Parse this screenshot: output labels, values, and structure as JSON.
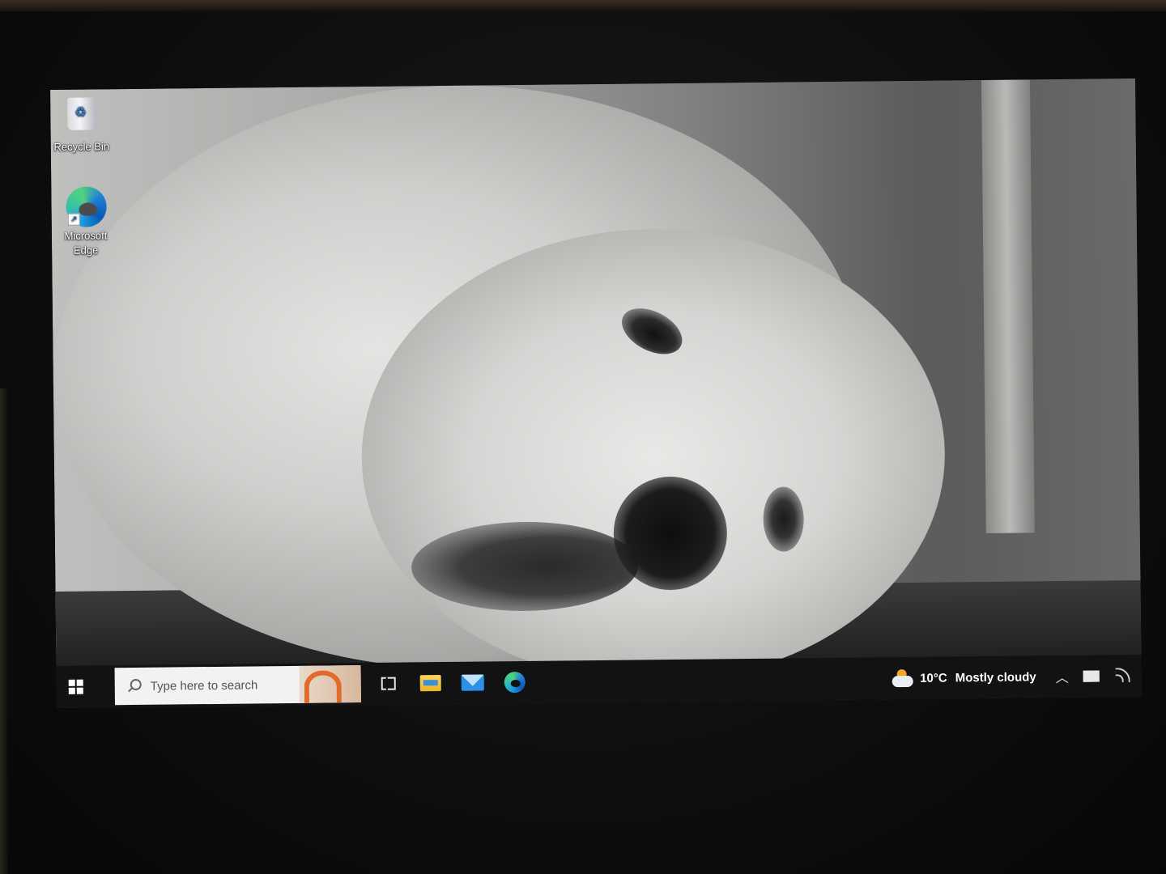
{
  "desktop": {
    "icons": [
      {
        "label": "Recycle Bin",
        "icon": "recycle-bin-icon"
      },
      {
        "label": "Microsoft Edge",
        "icon": "edge-icon"
      }
    ]
  },
  "taskbar": {
    "start_icon": "windows-logo-icon",
    "search": {
      "placeholder": "Type here to search"
    },
    "pinned": [
      {
        "name": "Task View",
        "icon": "task-view-icon"
      },
      {
        "name": "File Explorer",
        "icon": "folder-icon"
      },
      {
        "name": "Mail",
        "icon": "mail-icon"
      },
      {
        "name": "Microsoft Edge",
        "icon": "edge-icon"
      }
    ],
    "weather": {
      "temperature": "10°C",
      "condition": "Mostly cloudy",
      "icon": "cloud-sun-icon"
    },
    "tray": {
      "chevron_icon": "chevron-up-icon",
      "battery_icon": "battery-icon",
      "network_icon": "wifi-icon"
    }
  },
  "colors": {
    "taskbar_bg": "#101214",
    "search_bg": "#f2f2f2",
    "edge_blue": "#1b9de2",
    "edge_green": "#52d27d"
  }
}
